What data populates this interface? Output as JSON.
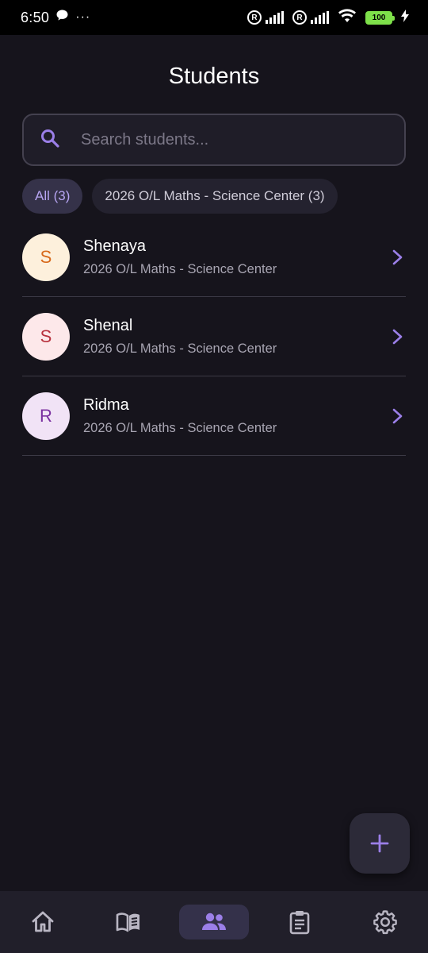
{
  "status_bar": {
    "time": "6:50",
    "more": "···",
    "battery": "100"
  },
  "header": {
    "title": "Students"
  },
  "search": {
    "placeholder": "Search students..."
  },
  "filters": [
    {
      "label": "All (3)",
      "selected": true
    },
    {
      "label": "2026 O/L Maths - Science Center (3)",
      "selected": false
    }
  ],
  "students": [
    {
      "initial": "S",
      "name": "Shenaya",
      "class": "2026 O/L Maths - Science Center",
      "avatar_bg": "#fdf0dc",
      "avatar_fg": "#d86a1c"
    },
    {
      "initial": "S",
      "name": "Shenal",
      "class": "2026 O/L Maths - Science Center",
      "avatar_bg": "#fde8ea",
      "avatar_fg": "#b8323e"
    },
    {
      "initial": "R",
      "name": "Ridma",
      "class": "2026 O/L Maths - Science Center",
      "avatar_bg": "#f1e3f6",
      "avatar_fg": "#7a2fa0"
    }
  ],
  "fab": {
    "icon": "plus-icon"
  },
  "bottom_nav": [
    {
      "icon": "home-icon",
      "active": false
    },
    {
      "icon": "book-icon",
      "active": false
    },
    {
      "icon": "people-icon",
      "active": true
    },
    {
      "icon": "clipboard-icon",
      "active": false
    },
    {
      "icon": "gear-icon",
      "active": false
    }
  ],
  "colors": {
    "background": "#16141c",
    "accent": "#9b7fe8",
    "nav_icon": "#b9b6c3"
  }
}
